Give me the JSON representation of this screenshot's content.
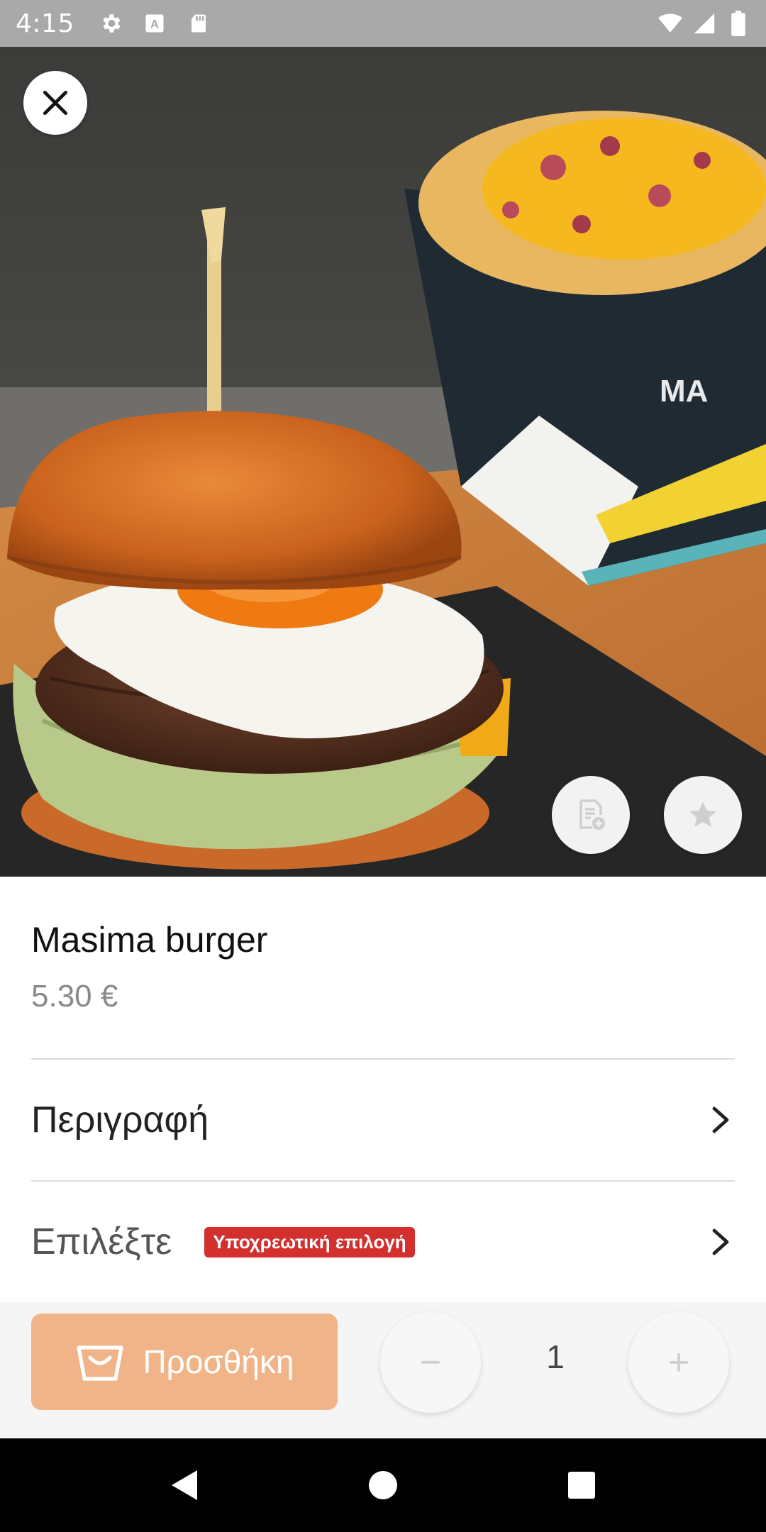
{
  "status_bar": {
    "time": "4:15",
    "icons": [
      "settings-icon",
      "a-font-icon",
      "sd-card-icon",
      "wifi-icon",
      "signal-icon",
      "battery-icon"
    ]
  },
  "hero": {
    "close_icon": "close-icon",
    "note_icon": "add-note-icon",
    "favorite_icon": "star-icon"
  },
  "product": {
    "name": "Masima burger",
    "price": "5.30 €"
  },
  "rows": {
    "description": "Περιγραφή",
    "select": "Επιλέξτε",
    "required_badge": "Υποχρεωτική επιλογή"
  },
  "actions": {
    "add_label": "Προσθήκη",
    "quantity": "1",
    "minus": "−",
    "plus": "+",
    "accent_color": "#f0b488"
  },
  "colors": {
    "badge": "#d32f2f",
    "status_bar": "#a9a9a9"
  }
}
